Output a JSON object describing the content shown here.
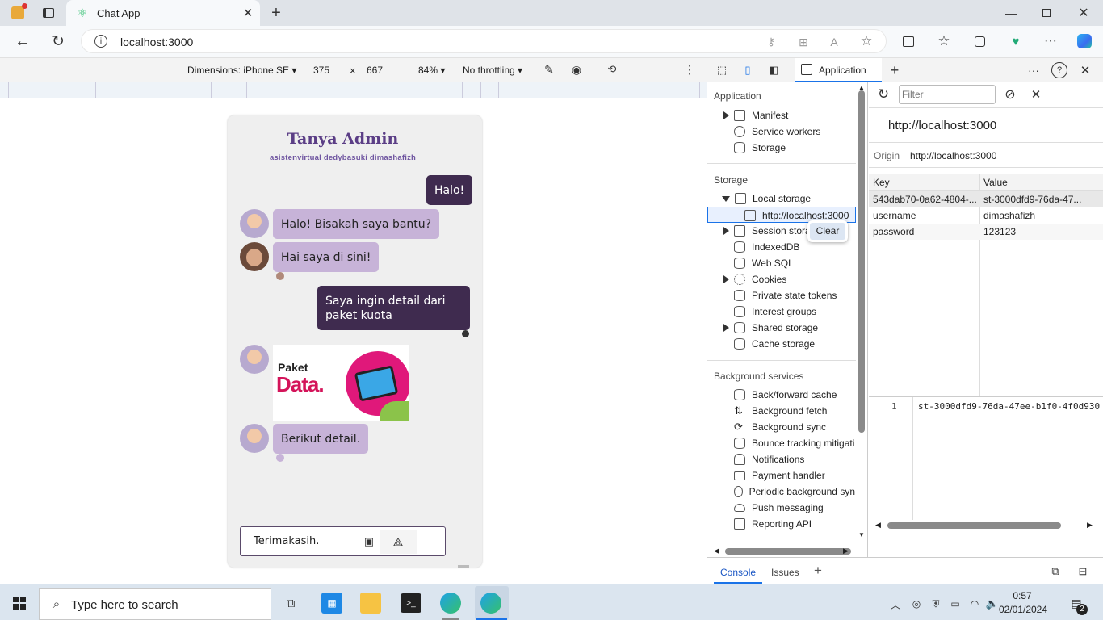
{
  "browser": {
    "tab_title": "Chat App",
    "url": "localhost:3000"
  },
  "emulation": {
    "device": "Dimensions: iPhone SE",
    "width": "375",
    "times": "×",
    "height": "667",
    "zoom": "84%",
    "throttling": "No throttling"
  },
  "chat": {
    "title": "Tanya Admin",
    "subtitle": "asistenvirtual dedybasuki dimashafizh",
    "messages": [
      {
        "text": "Halo!",
        "side": "out"
      },
      {
        "text": "Halo! Bisakah saya bantu?",
        "side": "in"
      },
      {
        "text": "Hai saya di sini!",
        "side": "in"
      },
      {
        "text": "Saya ingin detail dari paket kuota",
        "side": "out"
      },
      {
        "text": "Berikut detail.",
        "side": "in"
      }
    ],
    "image_caption_1": "Paket",
    "image_caption_2": "Data.",
    "input_value": "Terimakasih."
  },
  "devtools": {
    "active_tab": "Application",
    "filter_placeholder": "Filter",
    "origin_title": "http://localhost:3000",
    "origin_label": "Origin",
    "origin_value": "http://localhost:3000",
    "sidebar": {
      "application_head": "Application",
      "application_items": [
        "Manifest",
        "Service workers",
        "Storage"
      ],
      "storage_head": "Storage",
      "local_storage": "Local storage",
      "local_storage_child": "http://localhost:3000",
      "session_storage": "Session stora",
      "storage_items": [
        "IndexedDB",
        "Web SQL",
        "Cookies",
        "Private state tokens",
        "Interest groups",
        "Shared storage",
        "Cache storage"
      ],
      "bg_head": "Background services",
      "bg_items": [
        "Back/forward cache",
        "Background fetch",
        "Background sync",
        "Bounce tracking mitigati",
        "Notifications",
        "Payment handler",
        "Periodic background syn",
        "Push messaging",
        "Reporting API"
      ]
    },
    "context_menu": "Clear",
    "table": {
      "headers": [
        "Key",
        "Value"
      ],
      "rows": [
        [
          "543dab70-0a62-4804-...",
          "st-3000dfd9-76da-47..."
        ],
        [
          "username",
          "dimashafizh"
        ],
        [
          "password",
          "123123"
        ]
      ]
    },
    "preview_line": "1",
    "preview_text": "st-3000dfd9-76da-47ee-b1f0-4f0d930",
    "drawer_tabs": [
      "Console",
      "Issues"
    ]
  },
  "taskbar": {
    "search_placeholder": "Type here to search",
    "time": "0:57",
    "date": "02/01/2024",
    "notification_count": "2"
  }
}
